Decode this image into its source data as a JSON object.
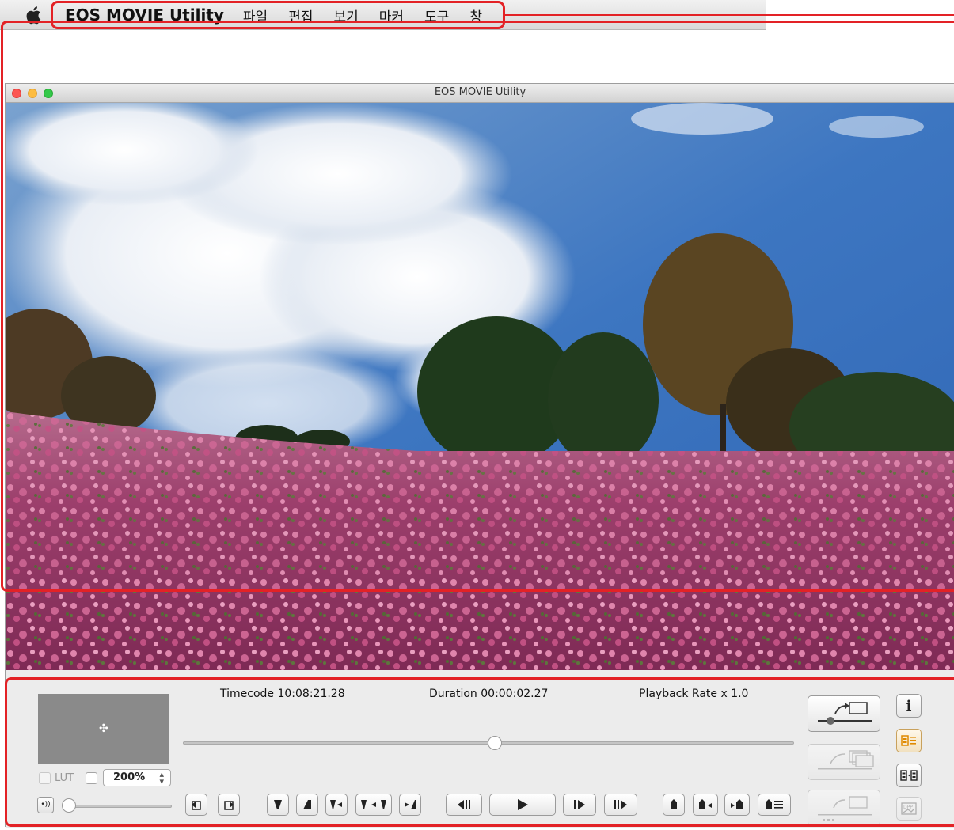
{
  "menubar": {
    "app_name": "EOS MOVIE Utility",
    "items": [
      "파일",
      "편집",
      "보기",
      "마커",
      "도구",
      "창"
    ]
  },
  "window": {
    "title": "EOS MOVIE Utility"
  },
  "controls": {
    "timecode": "Timecode 10:08:21.28",
    "duration": "Duration 00:00:02.27",
    "playback_rate": "Playback Rate x 1.0",
    "lut_label": "LUT",
    "lut_checked": false,
    "zoom_value": "200%",
    "seek_position": 0.51,
    "volume_level": 0.0
  },
  "colors": {
    "callout_red": "#e32226",
    "accent_orange": "#e08a00"
  }
}
